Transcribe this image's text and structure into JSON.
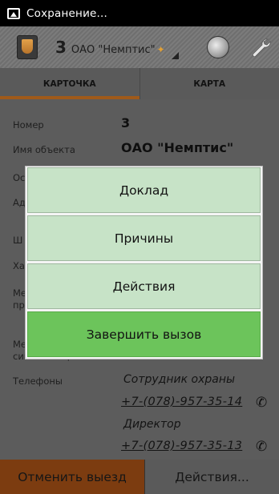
{
  "status_bar": {
    "text": "Сохранение..."
  },
  "action_bar": {
    "number": "3",
    "name": "ОАО \"Немптис\"",
    "star": "✦"
  },
  "tabs": [
    {
      "label": "КАРТОЧКА",
      "active": true
    },
    {
      "label": "КАРТА",
      "active": false
    }
  ],
  "card": {
    "number_label": "Номер",
    "number_value": "3",
    "object_label": "Имя объекта",
    "object_value": "ОАО \"Немптис\"",
    "row3_label": "Ос",
    "row4_label": "Ад",
    "row5_label": "Ш",
    "row6_label": "Ха",
    "row7_label": "Ме",
    "row7_label2": "пр",
    "row8_label": "Ме",
    "row8_label2": "сигнализации",
    "phones_label": "Телефоны",
    "contacts": [
      {
        "role": "Сотрудник охраны",
        "phone": "+7-(078)-957-35-14"
      },
      {
        "role": "Директор",
        "phone": "+7-(078)-957-35-13"
      }
    ]
  },
  "dialog": {
    "options": [
      "Доклад",
      "Причины",
      "Действия",
      "Завершить вызов"
    ]
  },
  "bottom": {
    "cancel_label": "Отменить выезд",
    "actions_label": "Действия..."
  },
  "colors": {
    "accent": "#e07a26",
    "dialog_button": "#c7e3c7",
    "dialog_primary": "#6cc45b"
  },
  "icons": {
    "status": "image-icon",
    "logo": "shield-logo-icon",
    "wrench": "wrench-icon",
    "phone": "phone-icon"
  }
}
